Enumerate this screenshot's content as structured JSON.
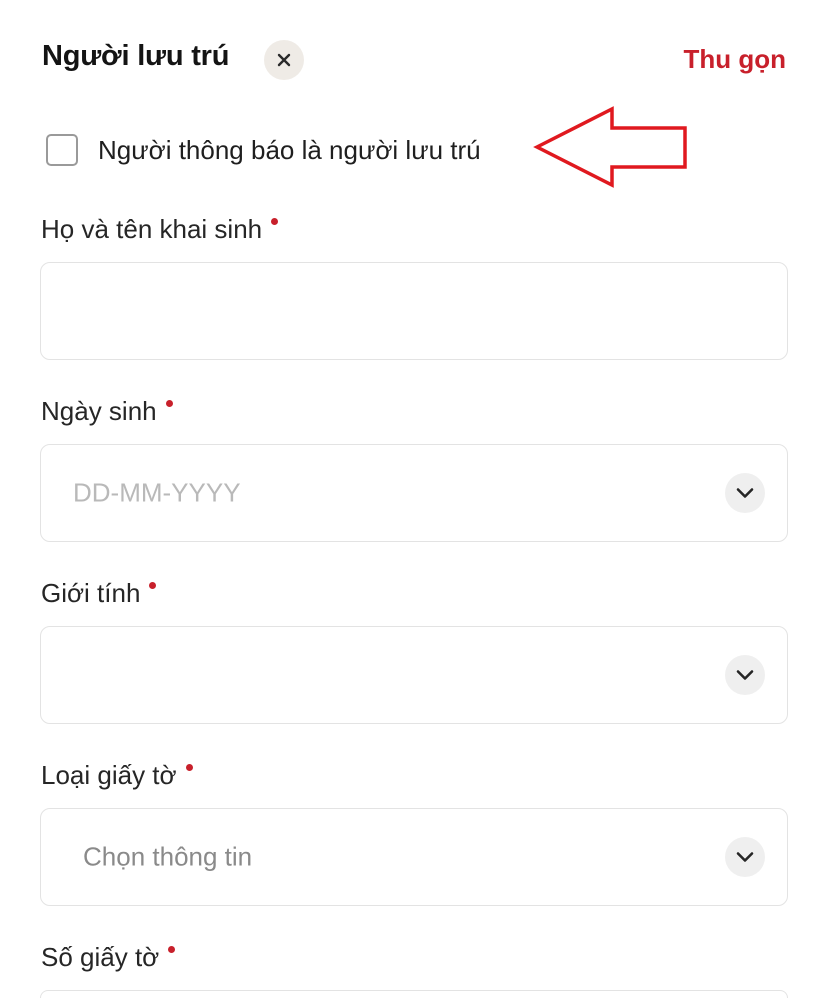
{
  "header": {
    "title": "Người lưu trú",
    "collapse_label": "Thu gọn"
  },
  "notifier_checkbox": {
    "label": "Người thông báo là người lưu trú",
    "checked": false
  },
  "fields": {
    "full_name": {
      "label": "Họ và tên khai sinh",
      "value": ""
    },
    "birth_date": {
      "label": "Ngày sinh",
      "placeholder": "DD-MM-YYYY"
    },
    "gender": {
      "label": "Giới tính",
      "value": ""
    },
    "document_type": {
      "label": "Loại giấy tờ",
      "placeholder": "Chọn thông tin"
    },
    "document_number": {
      "label": "Số giấy tờ"
    }
  },
  "colors": {
    "accent": "#c8202b",
    "annotation_arrow": "#e0191f",
    "close_button_bg": "#efebe6"
  },
  "icons": {
    "close": "close-icon",
    "dropdown": "chevron-down-icon",
    "annotation": "arrow-left-annotation"
  }
}
